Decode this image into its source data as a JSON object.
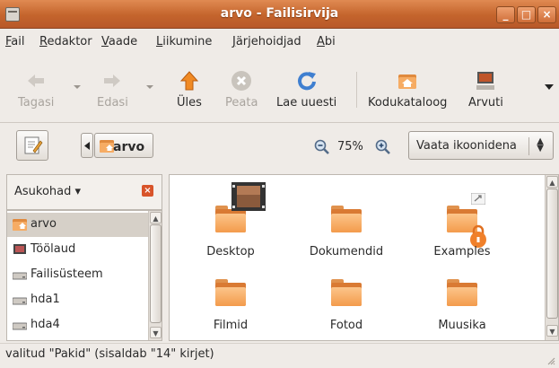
{
  "window": {
    "title": "arvo - Failisirvija",
    "minimize_label": "_",
    "maximize_label": "□",
    "close_label": "×"
  },
  "menu": [
    {
      "label": "Fail",
      "mnemonic": "F",
      "rest": "ail"
    },
    {
      "label": "Redaktor",
      "mnemonic": "R",
      "rest": "edaktor"
    },
    {
      "label": "Vaade",
      "mnemonic": "V",
      "rest": "aade"
    },
    {
      "label": "Liikumine",
      "mnemonic": "L",
      "rest": "iikumine"
    },
    {
      "label": "Järjehoidjad",
      "mnemonic": "J",
      "rest": "ärjehoidjad"
    },
    {
      "label": "Abi",
      "mnemonic": "A",
      "rest": "bi"
    }
  ],
  "toolbar": {
    "back": {
      "label": "Tagasi",
      "icon": "arrow-left-icon",
      "enabled": false
    },
    "forward": {
      "label": "Edasi",
      "icon": "arrow-right-icon",
      "enabled": false
    },
    "up": {
      "label": "Üles",
      "icon": "arrow-up-icon",
      "enabled": true
    },
    "stop": {
      "label": "Peata",
      "icon": "stop-icon",
      "enabled": false
    },
    "reload": {
      "label": "Lae uuesti",
      "icon": "reload-icon",
      "enabled": true
    },
    "home": {
      "label": "Kodukataloog",
      "icon": "home-folder-icon",
      "enabled": true
    },
    "computer": {
      "label": "Arvuti",
      "icon": "computer-icon",
      "enabled": true
    },
    "overflow": {
      "icon": "overflow-chevron-icon"
    }
  },
  "locationbar": {
    "breadcrumb": "arvo",
    "zoom": "75%",
    "view_mode": "Vaata ikoonidena"
  },
  "sidepane": {
    "header": "Asukohad",
    "close_label": "×",
    "items": [
      {
        "label": "arvo",
        "icon": "home-folder-icon",
        "selected": true
      },
      {
        "label": "Töölaud",
        "icon": "desktop-icon",
        "selected": false
      },
      {
        "label": "Failisüsteem",
        "icon": "drive-icon",
        "selected": false
      },
      {
        "label": "hda1",
        "icon": "drive-icon",
        "selected": false
      },
      {
        "label": "hda4",
        "icon": "drive-icon",
        "selected": false
      }
    ]
  },
  "files": [
    {
      "label": "Desktop",
      "icon": "folder-icon",
      "emblem": "video-thumbnail"
    },
    {
      "label": "Dokumendid",
      "icon": "folder-icon"
    },
    {
      "label": "Examples",
      "icon": "folder-icon",
      "emblem": "lock"
    },
    {
      "label": "Filmid",
      "icon": "folder-icon"
    },
    {
      "label": "Fotod",
      "icon": "folder-icon"
    },
    {
      "label": "Muusika",
      "icon": "folder-icon"
    }
  ],
  "status": "valitud \"Pakid\" (sisaldab \"14\" kirjet)",
  "colors": {
    "titlebar": "#c4642c",
    "folder": "#f39b4c",
    "selection": "#d6d0c8"
  }
}
